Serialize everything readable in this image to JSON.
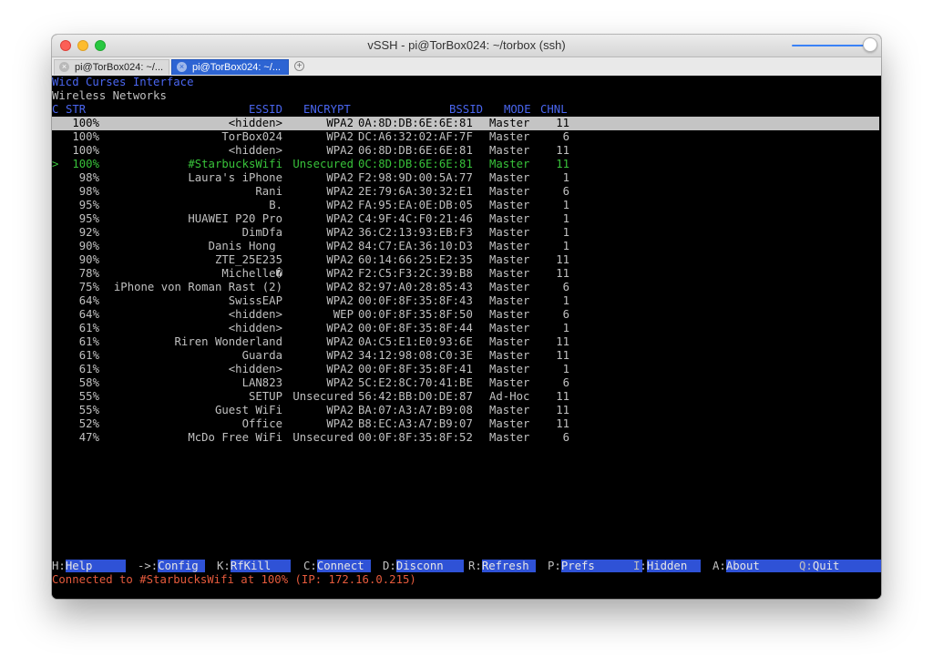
{
  "window": {
    "title": "vSSH - pi@TorBox024: ~/torbox (ssh)",
    "tabs": [
      {
        "label": "pi@TorBox024: ~/...",
        "active": false
      },
      {
        "label": "pi@TorBox024: ~/...",
        "active": true
      }
    ],
    "new_tab_glyph": "+"
  },
  "terminal": {
    "header_right": "Wicd Curses Interface",
    "heading": "Wireless Networks",
    "columns": {
      "c": "C",
      "str": "STR",
      "essid": "ESSID",
      "encrypt": "ENCRYPT",
      "bssid": "BSSID",
      "mode": "MODE",
      "chnl": "CHNL"
    },
    "networks": [
      {
        "sel": "",
        "str": "100%",
        "essid": "<hidden>",
        "encrypt": "WPA2",
        "bssid": "0A:8D:DB:6E:6E:81",
        "mode": "Master",
        "chnl": "11"
      },
      {
        "sel": "",
        "str": "100%",
        "essid": "TorBox024",
        "encrypt": "WPA2",
        "bssid": "DC:A6:32:02:AF:7F",
        "mode": "Master",
        "chnl": "6"
      },
      {
        "sel": "",
        "str": "100%",
        "essid": "<hidden>",
        "encrypt": "WPA2",
        "bssid": "06:8D:DB:6E:6E:81",
        "mode": "Master",
        "chnl": "11"
      },
      {
        "sel": ">",
        "str": "100%",
        "essid": "#StarbucksWifi",
        "encrypt": "Unsecured",
        "bssid": "0C:8D:DB:6E:6E:81",
        "mode": "Master",
        "chnl": "11"
      },
      {
        "sel": "",
        "str": "98%",
        "essid": "Laura's iPhone",
        "encrypt": "WPA2",
        "bssid": "F2:98:9D:00:5A:77",
        "mode": "Master",
        "chnl": "1"
      },
      {
        "sel": "",
        "str": "98%",
        "essid": "Rani",
        "encrypt": "WPA2",
        "bssid": "2E:79:6A:30:32:E1",
        "mode": "Master",
        "chnl": "6"
      },
      {
        "sel": "",
        "str": "95%",
        "essid": "B.",
        "encrypt": "WPA2",
        "bssid": "FA:95:EA:0E:DB:05",
        "mode": "Master",
        "chnl": "1"
      },
      {
        "sel": "",
        "str": "95%",
        "essid": "HUAWEI P20 Pro",
        "encrypt": "WPA2",
        "bssid": "C4:9F:4C:F0:21:46",
        "mode": "Master",
        "chnl": "1"
      },
      {
        "sel": "",
        "str": "92%",
        "essid": "DimDfa",
        "encrypt": "WPA2",
        "bssid": "36:C2:13:93:EB:F3",
        "mode": "Master",
        "chnl": "1"
      },
      {
        "sel": "",
        "str": "90%",
        "essid": "Danis Hong ",
        "encrypt": "WPA2",
        "bssid": "84:C7:EA:36:10:D3",
        "mode": "Master",
        "chnl": "1"
      },
      {
        "sel": "",
        "str": "90%",
        "essid": "ZTE_25E235",
        "encrypt": "WPA2",
        "bssid": "60:14:66:25:E2:35",
        "mode": "Master",
        "chnl": "11"
      },
      {
        "sel": "",
        "str": "78%",
        "essid": "Michelle�",
        "encrypt": "WPA2",
        "bssid": "F2:C5:F3:2C:39:B8",
        "mode": "Master",
        "chnl": "11"
      },
      {
        "sel": "",
        "str": "75%",
        "essid": "iPhone von Roman Rast (2)",
        "encrypt": "WPA2",
        "bssid": "82:97:A0:28:85:43",
        "mode": "Master",
        "chnl": "6"
      },
      {
        "sel": "",
        "str": "64%",
        "essid": "SwissEAP",
        "encrypt": "WPA2",
        "bssid": "00:0F:8F:35:8F:43",
        "mode": "Master",
        "chnl": "1"
      },
      {
        "sel": "",
        "str": "64%",
        "essid": "<hidden>",
        "encrypt": "WEP",
        "bssid": "00:0F:8F:35:8F:50",
        "mode": "Master",
        "chnl": "6"
      },
      {
        "sel": "",
        "str": "61%",
        "essid": "<hidden>",
        "encrypt": "WPA2",
        "bssid": "00:0F:8F:35:8F:44",
        "mode": "Master",
        "chnl": "1"
      },
      {
        "sel": "",
        "str": "61%",
        "essid": "Riren Wonderland",
        "encrypt": "WPA2",
        "bssid": "0A:C5:E1:E0:93:6E",
        "mode": "Master",
        "chnl": "11"
      },
      {
        "sel": "",
        "str": "61%",
        "essid": "Guarda",
        "encrypt": "WPA2",
        "bssid": "34:12:98:08:C0:3E",
        "mode": "Master",
        "chnl": "11"
      },
      {
        "sel": "",
        "str": "61%",
        "essid": "<hidden>",
        "encrypt": "WPA2",
        "bssid": "00:0F:8F:35:8F:41",
        "mode": "Master",
        "chnl": "1"
      },
      {
        "sel": "",
        "str": "58%",
        "essid": "LAN823",
        "encrypt": "WPA2",
        "bssid": "5C:E2:8C:70:41:BE",
        "mode": "Master",
        "chnl": "6"
      },
      {
        "sel": "",
        "str": "55%",
        "essid": "SETUP",
        "encrypt": "Unsecured",
        "bssid": "56:42:BB:D0:DE:87",
        "mode": "Ad-Hoc",
        "chnl": "11"
      },
      {
        "sel": "",
        "str": "55%",
        "essid": "Guest WiFi",
        "encrypt": "WPA2",
        "bssid": "BA:07:A3:A7:B9:08",
        "mode": "Master",
        "chnl": "11"
      },
      {
        "sel": "",
        "str": "52%",
        "essid": "Office",
        "encrypt": "WPA2",
        "bssid": "B8:EC:A3:A7:B9:07",
        "mode": "Master",
        "chnl": "11"
      },
      {
        "sel": "",
        "str": "47%",
        "essid": "McDo Free WiFi",
        "encrypt": "Unsecured",
        "bssid": "00:0F:8F:35:8F:52",
        "mode": "Master",
        "chnl": "6"
      }
    ],
    "menu": [
      {
        "key": "H:",
        "label": "Help     "
      },
      {
        "key": "->:",
        "label": "Config "
      },
      {
        "key": "K:",
        "label": "RfKill   "
      },
      {
        "key": "C:",
        "label": "Connect "
      },
      {
        "key": "D:",
        "label": "Disconn   "
      },
      {
        "key": "R:",
        "label": "Refresh "
      },
      {
        "key": "P:",
        "label": "Prefs       "
      },
      {
        "key": "I:",
        "label": "Hidden  "
      },
      {
        "key": "A:",
        "label": "About        "
      },
      {
        "key": "Q:",
        "label": "Quit          "
      }
    ],
    "status": "Connected to #StarbucksWifi at 100% (IP: 172.16.0.215)"
  },
  "colors": {
    "connected_row": "#38c23a",
    "highlight_row": "#c4c4c4",
    "header_blue": "#4a66f0",
    "menu_bg": "#2f52d6",
    "status_text": "#e55a3c"
  }
}
